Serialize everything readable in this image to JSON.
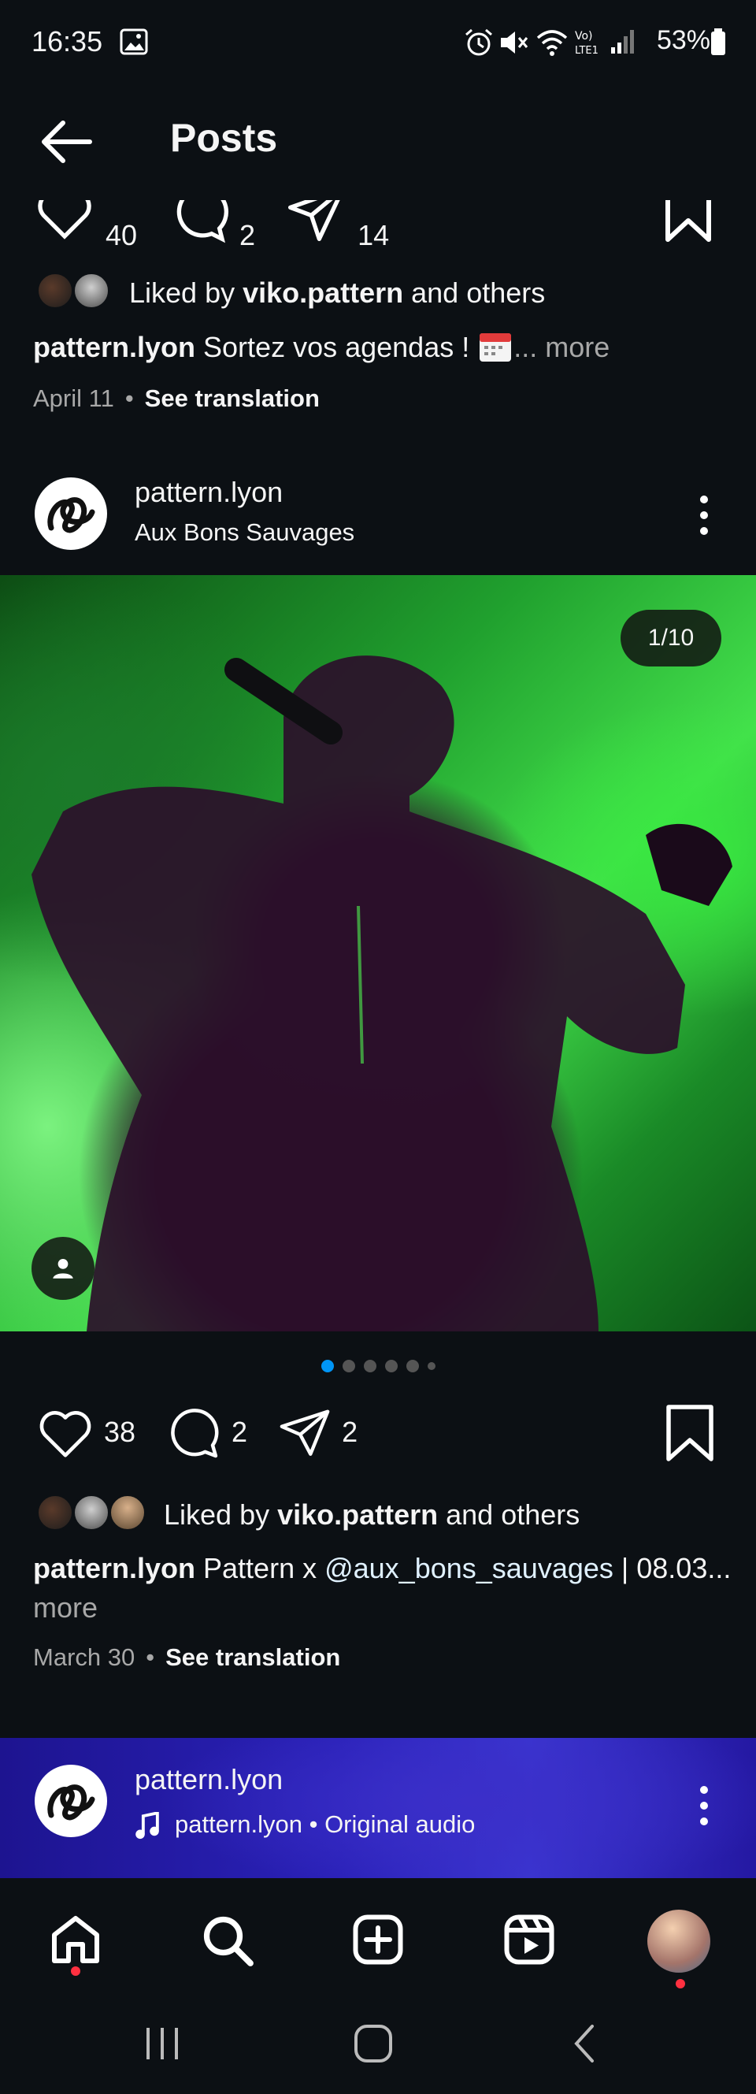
{
  "status_bar": {
    "time": "16:35",
    "battery": "53%"
  },
  "header": {
    "title": "Posts"
  },
  "post1": {
    "counts": {
      "likes": "40",
      "comments": "2",
      "shares": "14"
    },
    "liked_by": {
      "prefix": "Liked by ",
      "user": "viko.pattern",
      "suffix": " and others"
    },
    "caption": {
      "user": "pattern.lyon",
      "text": " Sortez vos agendas ! ",
      "ellipsis": "...",
      "more": " more"
    },
    "date": "April 11",
    "see_translation": "See translation"
  },
  "post2": {
    "username": "pattern.lyon",
    "location": "Aux Bons Sauvages",
    "image_counter": "1/10",
    "counts": {
      "likes": "38",
      "comments": "2",
      "shares": "2"
    },
    "liked_by": {
      "prefix": "Liked by ",
      "user": "viko.pattern",
      "suffix": " and others"
    },
    "caption": {
      "user": "pattern.lyon",
      "text": " Pattern x ",
      "mention": "@aux_bons_sauvages",
      "rest": " | 08.03...",
      "more": "more"
    },
    "date": "March 30",
    "see_translation": "See translation"
  },
  "post3": {
    "username": "pattern.lyon",
    "audio": "pattern.lyon • Original audio"
  },
  "icons": {
    "back": "arrow-left",
    "heart": "heart",
    "comment": "comment-bubble",
    "share": "paper-plane",
    "save": "bookmark",
    "more": "vertical-dots",
    "tag": "person",
    "music": "music-note",
    "home": "home",
    "search": "magnifier",
    "create": "plus-square",
    "reels": "reels",
    "profile": "avatar"
  },
  "colors": {
    "accent": "#0095f6",
    "background": "#0c1014",
    "notification": "#ff3040"
  }
}
